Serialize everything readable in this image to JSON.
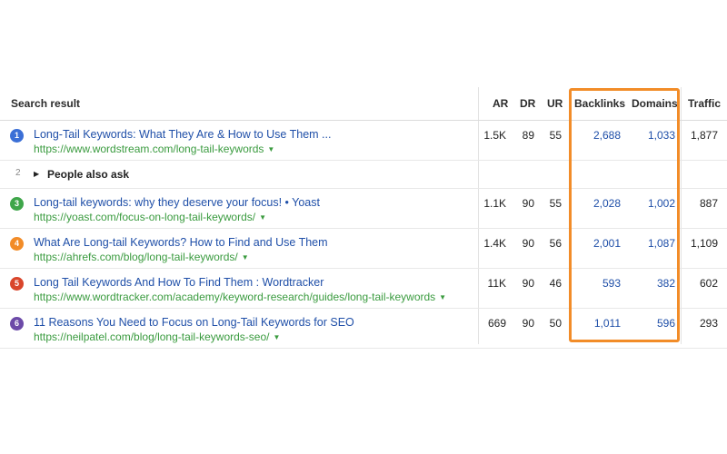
{
  "header": {
    "search_result": "Search result",
    "ar": "AR",
    "dr": "DR",
    "ur": "UR",
    "backlinks": "Backlinks",
    "domains": "Domains",
    "traffic": "Traffic"
  },
  "rows": [
    {
      "num": "1",
      "badge_color": "#3b6fd6",
      "title": "Long-Tail Keywords: What They Are & How to Use Them ...",
      "url": "https://www.wordstream.com/long-tail-keywords",
      "ar": "1.5K",
      "dr": "89",
      "ur": "55",
      "backlinks": "2,688",
      "domains": "1,033",
      "traffic": "1,877"
    },
    {
      "num": "3",
      "badge_color": "#3fa64a",
      "title": "Long-tail keywords: why they deserve your focus! • Yoast",
      "url": "https://yoast.com/focus-on-long-tail-keywords/",
      "ar": "1.1K",
      "dr": "90",
      "ur": "55",
      "backlinks": "2,028",
      "domains": "1,002",
      "traffic": "887"
    },
    {
      "num": "4",
      "badge_color": "#f28c28",
      "title": "What Are Long-tail Keywords? How to Find and Use Them",
      "url": "https://ahrefs.com/blog/long-tail-keywords/",
      "ar": "1.4K",
      "dr": "90",
      "ur": "56",
      "backlinks": "2,001",
      "domains": "1,087",
      "traffic": "1,109"
    },
    {
      "num": "5",
      "badge_color": "#d9452b",
      "title": "Long Tail Keywords And How To Find Them : Wordtracker",
      "url": "https://www.wordtracker.com/academy/keyword-research/guides/long-tail-keywords",
      "ar": "11K",
      "dr": "90",
      "ur": "46",
      "backlinks": "593",
      "domains": "382",
      "traffic": "602"
    },
    {
      "num": "6",
      "badge_color": "#6c4aa8",
      "title": "11 Reasons You Need to Focus on Long-Tail Keywords for SEO",
      "url": "https://neilpatel.com/blog/long-tail-keywords-seo/",
      "ar": "669",
      "dr": "90",
      "ur": "50",
      "backlinks": "1,011",
      "domains": "596",
      "traffic": "293"
    }
  ],
  "people_also_ask": {
    "num": "2",
    "label": "People also ask"
  },
  "highlight_color": "#f28c28"
}
